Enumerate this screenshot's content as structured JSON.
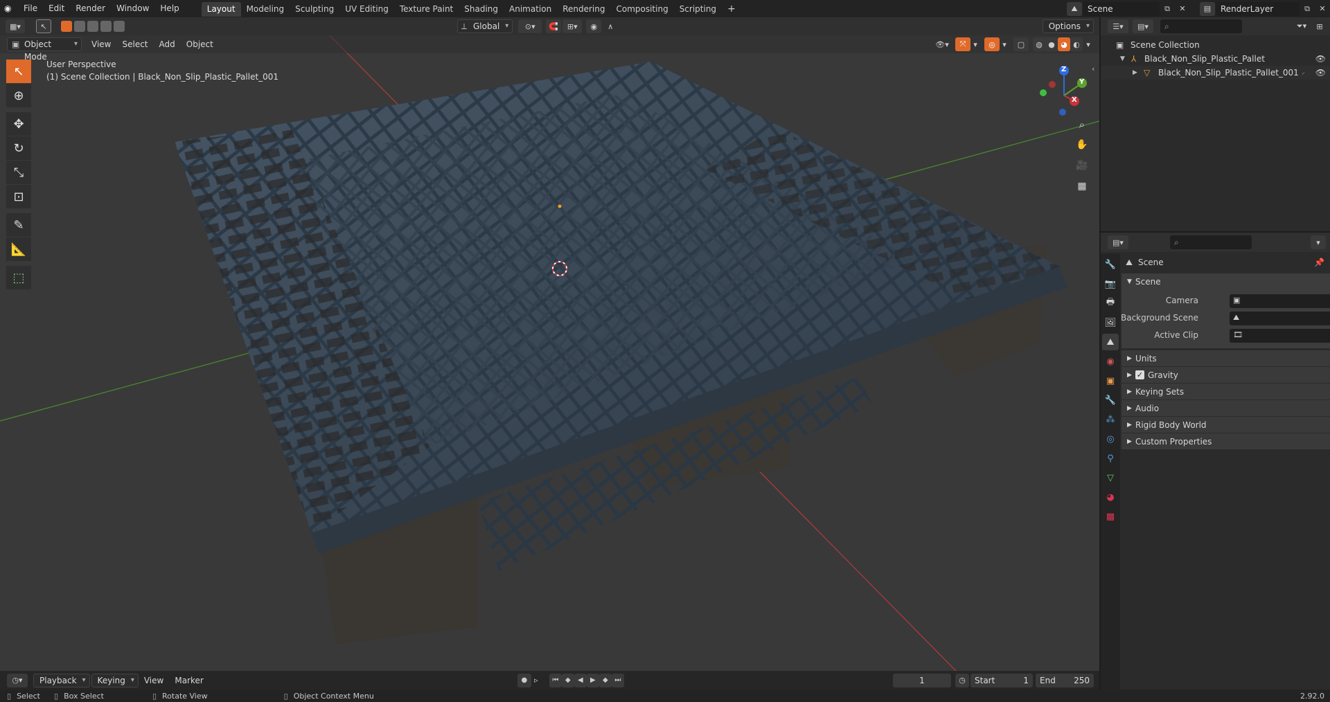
{
  "topbar": {
    "menus": [
      "File",
      "Edit",
      "Render",
      "Window",
      "Help"
    ],
    "workspaces": [
      "Layout",
      "Modeling",
      "Sculpting",
      "UV Editing",
      "Texture Paint",
      "Shading",
      "Animation",
      "Rendering",
      "Compositing",
      "Scripting"
    ],
    "active_workspace": "Layout",
    "add_tab": "+",
    "scene": "Scene",
    "view_layer": "RenderLayer"
  },
  "tool_header": {
    "transform_orientation": "Global",
    "options": "Options"
  },
  "viewport_header": {
    "mode": "Object Mode",
    "menus": [
      "View",
      "Select",
      "Add",
      "Object"
    ]
  },
  "viewport": {
    "perspective": "User Perspective",
    "collection_info": "(1) Scene Collection | Black_Non_Slip_Plastic_Pallet_001"
  },
  "gizmo": {
    "x": "X",
    "y": "Y",
    "z": "Z"
  },
  "outliner": {
    "items": [
      {
        "label": "Scene Collection"
      },
      {
        "label": "Black_Non_Slip_Plastic_Pallet"
      },
      {
        "label": "Black_Non_Slip_Plastic_Pallet_001"
      }
    ]
  },
  "properties": {
    "context": "Scene",
    "panel_title": "Scene",
    "fields": [
      {
        "label": "Camera"
      },
      {
        "label": "Background Scene"
      },
      {
        "label": "Active Clip"
      }
    ],
    "subpanels": [
      "Units",
      "Gravity",
      "Keying Sets",
      "Audio",
      "Rigid Body World",
      "Custom Properties"
    ],
    "gravity_checked": true
  },
  "timeline": {
    "menus": [
      "Playback",
      "Keying",
      "View",
      "Marker"
    ],
    "current_frame": "1",
    "start_label": "Start",
    "start": "1",
    "end_label": "End",
    "end": "250"
  },
  "status": {
    "select": "Select",
    "box_select": "Box Select",
    "rotate_view": "Rotate View",
    "context_menu": "Object Context Menu",
    "version": "2.92.0"
  },
  "colors": {
    "accent": "#e06a2a",
    "x_axis": "#c8333a",
    "y_axis": "#5ea22f",
    "z_axis": "#2f6ae0",
    "pallet": "#3b4a5a"
  }
}
